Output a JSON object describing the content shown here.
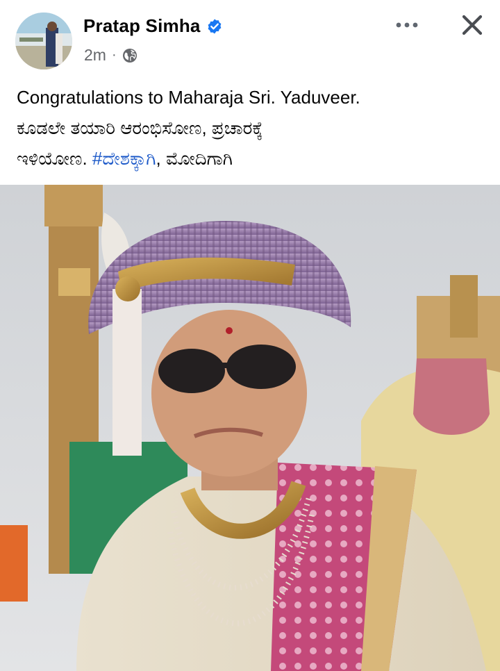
{
  "post": {
    "author": "Pratap Simha",
    "time": "2m",
    "separator": "·",
    "caption_line1": "Congratulations to Maharaja Sri. Yaduveer.",
    "caption_line2": "ಕೂಡಲೇ ತಯಾರಿ ಆರಂಭಿಸೋಣ, ಪ್ರಚಾರಕ್ಕೆ",
    "caption_line3_prefix": "ಇಳಿಯೋಣ. ",
    "hashtag": "#ದೇಶಕ್ಕಾಗಿ",
    "caption_line3_suffix": ", ಮೋದಿಗಾಗಿ"
  },
  "icons": {
    "verified": "verified-badge-icon",
    "privacy": "globe-icon",
    "more": "more-options-icon",
    "close": "close-icon"
  },
  "colors": {
    "text": "#050505",
    "meta": "#65676b",
    "link": "#1b58c8",
    "verified": "#1877f2"
  }
}
